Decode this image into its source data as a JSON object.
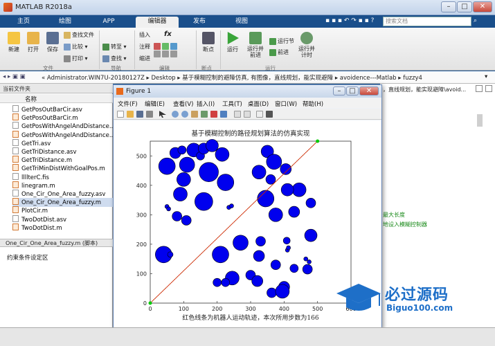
{
  "window": {
    "title": "MATLAB R2018a",
    "min": "–",
    "max": "□",
    "close": "✕"
  },
  "tabs": [
    "主页",
    "绘图",
    "APP",
    "编辑器",
    "发布",
    "视图"
  ],
  "search_placeholder": "搜索文档",
  "ribbon": {
    "new": "新建",
    "open": "打开",
    "save": "保存",
    "find_files": "查找文件",
    "compare": "比较",
    "print": "打印",
    "comment_btn": "注释",
    "indent_btn": "缩进",
    "insert": "插入",
    "fx": "fx",
    "goto": "转至",
    "find": "查找",
    "breakpoints": "断点",
    "run": "运行",
    "run_advance": "运行并\n前进",
    "run_section": "运行节",
    "advance": "前进",
    "run_time": "运行并\n计时",
    "groups": {
      "file": "文件",
      "nav": "导航",
      "edit": "编辑",
      "bp": "断点",
      "run": "运行"
    }
  },
  "address": "« Administrator.WIN7U-20180127Z ▸ Desktop ▸ 基于模糊控制的避障仿真, 有图像，直线规划，能实现避障 ▸ avoidence---Matlab ▸ fuzzy4",
  "left_panel": {
    "header": "当前文件夹",
    "col_name": "名称",
    "files": [
      {
        "name": "GetPosOutBarCir.asv",
        "type": "asv"
      },
      {
        "name": "GetPosOutBarCir.m",
        "type": "m"
      },
      {
        "name": "GetPosWithAngelAndDistance...",
        "type": "asv"
      },
      {
        "name": "GetPosWithAngelAndDistance...",
        "type": "m"
      },
      {
        "name": "GetTri.asv",
        "type": "asv"
      },
      {
        "name": "GetTriDistance.asv",
        "type": "asv"
      },
      {
        "name": "GetTriDistance.m",
        "type": "m"
      },
      {
        "name": "GetTriMinDistWithGoalPos.m",
        "type": "m"
      },
      {
        "name": "llllterC.fis",
        "type": "fis"
      },
      {
        "name": "linegram.m",
        "type": "m"
      },
      {
        "name": "One_Cir_One_Area_fuzzy.asv",
        "type": "asv"
      },
      {
        "name": "One_Cir_One_Area_fuzzy.m",
        "type": "m",
        "selected": true
      },
      {
        "name": "PlotCir.m",
        "type": "m"
      },
      {
        "name": "TwoDotDist.asv",
        "type": "asv"
      },
      {
        "name": "TwoDotDist.m",
        "type": "m"
      }
    ],
    "detail": "One_Cir_One_Area_fuzzy.m  (脚本)",
    "workspace_label": "约束条件设定区"
  },
  "right_panel": {
    "snippet1": "，直线规划，能实现避障\\avoid...",
    "snippet2": "最大长度",
    "snippet3": "地设入模糊控制器"
  },
  "figure": {
    "title": "Figure 1",
    "menu": [
      "文件(F)",
      "编辑(E)",
      "查看(V)",
      "插入(I)",
      "工具(T)",
      "桌面(D)",
      "窗口(W)",
      "帮助(H)"
    ],
    "plot_title": "基于模糊控制的路径规划算法的仿真实现",
    "xlabel": "红色线条为机器人运动轨迹，本次所用步数为166"
  },
  "chart_data": {
    "type": "scatter",
    "title": "基于模糊控制的路径规划算法的仿真实现",
    "xlabel": "红色线条为机器人运动轨迹，本次所用步数为166",
    "ylabel": "",
    "xlim": [
      0,
      600
    ],
    "ylim": [
      0,
      550
    ],
    "xticks": [
      0,
      100,
      200,
      300,
      400,
      500,
      600
    ],
    "yticks": [
      0,
      100,
      200,
      300,
      400,
      500
    ],
    "obstacle_color": "#0000ee",
    "path_color": "#ff0000",
    "line_color": "#00cc00",
    "start": [
      0,
      0
    ],
    "goal": [
      500,
      550
    ],
    "obstacles": [
      {
        "x": 50,
        "y": 465,
        "r": 12
      },
      {
        "x": 75,
        "y": 510,
        "r": 8
      },
      {
        "x": 95,
        "y": 520,
        "r": 6
      },
      {
        "x": 130,
        "y": 520,
        "r": 10
      },
      {
        "x": 110,
        "y": 470,
        "r": 11
      },
      {
        "x": 150,
        "y": 500,
        "r": 6
      },
      {
        "x": 160,
        "y": 525,
        "r": 8
      },
      {
        "x": 185,
        "y": 535,
        "r": 9
      },
      {
        "x": 100,
        "y": 420,
        "r": 10
      },
      {
        "x": 175,
        "y": 445,
        "r": 14
      },
      {
        "x": 215,
        "y": 505,
        "r": 10
      },
      {
        "x": 225,
        "y": 410,
        "r": 12
      },
      {
        "x": 90,
        "y": 370,
        "r": 10
      },
      {
        "x": 160,
        "y": 345,
        "r": 13
      },
      {
        "x": 50,
        "y": 328,
        "r": 3
      },
      {
        "x": 55,
        "y": 320,
        "r": 3
      },
      {
        "x": 80,
        "y": 295,
        "r": 7
      },
      {
        "x": 108,
        "y": 281,
        "r": 7
      },
      {
        "x": 235,
        "y": 325,
        "r": 3
      },
      {
        "x": 243,
        "y": 330,
        "r": 3
      },
      {
        "x": 350,
        "y": 515,
        "r": 9
      },
      {
        "x": 370,
        "y": 480,
        "r": 11
      },
      {
        "x": 325,
        "y": 445,
        "r": 10
      },
      {
        "x": 360,
        "y": 420,
        "r": 7
      },
      {
        "x": 405,
        "y": 455,
        "r": 8
      },
      {
        "x": 445,
        "y": 385,
        "r": 10
      },
      {
        "x": 345,
        "y": 355,
        "r": 12
      },
      {
        "x": 410,
        "y": 385,
        "r": 9
      },
      {
        "x": 480,
        "y": 340,
        "r": 7
      },
      {
        "x": 375,
        "y": 300,
        "r": 10
      },
      {
        "x": 430,
        "y": 310,
        "r": 8
      },
      {
        "x": 480,
        "y": 230,
        "r": 9
      },
      {
        "x": 270,
        "y": 205,
        "r": 11
      },
      {
        "x": 330,
        "y": 210,
        "r": 7
      },
      {
        "x": 408,
        "y": 212,
        "r": 5
      },
      {
        "x": 40,
        "y": 165,
        "r": 12
      },
      {
        "x": 60,
        "y": 165,
        "r": 4
      },
      {
        "x": 210,
        "y": 165,
        "r": 12
      },
      {
        "x": 325,
        "y": 160,
        "r": 8
      },
      {
        "x": 410,
        "y": 180,
        "r": 3
      },
      {
        "x": 413,
        "y": 188,
        "r": 3
      },
      {
        "x": 465,
        "y": 150,
        "r": 3
      },
      {
        "x": 475,
        "y": 140,
        "r": 3
      },
      {
        "x": 470,
        "y": 115,
        "r": 7
      },
      {
        "x": 375,
        "y": 130,
        "r": 7
      },
      {
        "x": 430,
        "y": 118,
        "r": 6
      },
      {
        "x": 245,
        "y": 85,
        "r": 10
      },
      {
        "x": 200,
        "y": 70,
        "r": 6
      },
      {
        "x": 225,
        "y": 70,
        "r": 6
      },
      {
        "x": 300,
        "y": 95,
        "r": 7
      },
      {
        "x": 320,
        "y": 75,
        "r": 8
      },
      {
        "x": 400,
        "y": 55,
        "r": 8
      },
      {
        "x": 363,
        "y": 35,
        "r": 7
      },
      {
        "x": 395,
        "y": 40,
        "r": 10
      }
    ]
  },
  "watermark": {
    "line1": "必过源码",
    "line2": "Biguo100.com"
  }
}
